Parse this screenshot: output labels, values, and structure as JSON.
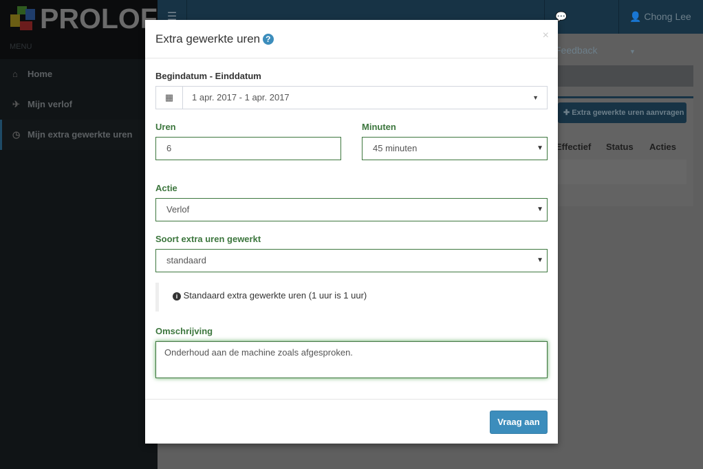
{
  "app": {
    "logo_text": "PROLOF",
    "menu_label": "MENU"
  },
  "topbar": {
    "feedback": "Feedback",
    "user": "Chong Lee"
  },
  "sidebar": {
    "items": [
      {
        "label": "Home",
        "icon": "home-icon"
      },
      {
        "label": "Mijn verlof",
        "icon": "plane-icon"
      },
      {
        "label": "Mijn extra gewerkte uren",
        "icon": "clock-icon",
        "active": true
      }
    ]
  },
  "background": {
    "add_button": "Extra gewerkte uren aanvragen",
    "columns": [
      "Effectief",
      "Status",
      "Acties"
    ]
  },
  "modal": {
    "title": "Extra gewerkte uren",
    "close": "×",
    "date_label": "Begindatum - Einddatum",
    "date_value": "1 apr. 2017 - 1 apr. 2017",
    "hours_label": "Uren",
    "hours_value": "6",
    "minutes_label": "Minuten",
    "minutes_value": "45 minuten",
    "action_label": "Actie",
    "action_value": "Verlof",
    "type_label": "Soort extra uren gewerkt",
    "type_value": "standaard",
    "info": "Standaard extra gewerkte uren (1 uur is 1 uur)",
    "desc_label": "Omschrijving",
    "desc_value": "Onderhoud aan de machine zoals afgesproken.",
    "submit": "Vraag aan"
  },
  "colors": {
    "accent": "#3c8dbc",
    "success": "#3c763d",
    "header": "#173345"
  }
}
